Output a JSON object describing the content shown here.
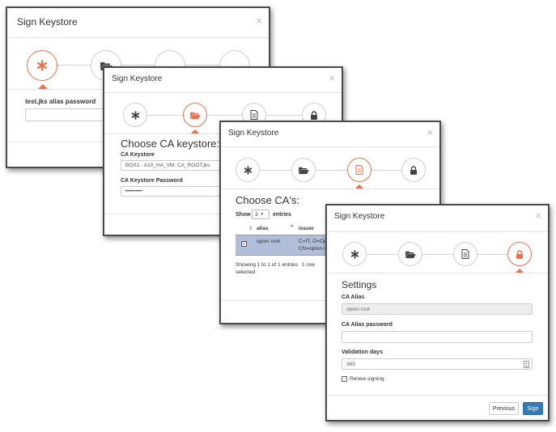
{
  "dialog_title": "Sign Keystore",
  "close_symbol": "×",
  "accent_color": "#e8734e",
  "primary_color": "#337ab7",
  "step_icons": [
    "asterisk-icon",
    "folder-open-icon",
    "file-text-icon",
    "lock-icon"
  ],
  "step1": {
    "field_label": "test.jks alias password",
    "field_value": ""
  },
  "step2": {
    "heading": "Choose CA keystore:",
    "keystore_label": "CA Keystore",
    "keystore_value": "BOX1 - A10_HA_VM: CA_ROOT.jks",
    "password_label": "CA Keystore Password",
    "password_value": "••••••••••"
  },
  "step3": {
    "heading": "Choose CA's:",
    "show_label": "Show",
    "page_size": "3",
    "entries_label": "entries",
    "columns": [
      "alias",
      "issuer"
    ],
    "rows": [
      {
        "alias": "opion root",
        "issuer_line1": "C=IT, O=Op",
        "issuer_line2": "CN=opion ro"
      }
    ],
    "info_text": "Showing 1 to 1 of 1 entries",
    "selected_text": "1 row",
    "selected_text2": "selected"
  },
  "step4": {
    "heading": "Settings",
    "ca_alias_label": "CA Alias",
    "ca_alias_value": "opion root",
    "ca_alias_password_label": "CA Alias password",
    "ca_alias_password_value": "",
    "validation_days_label": "Validation days",
    "validation_days_value": "365",
    "renew_label": "Renew signing",
    "previous_button": "Previous",
    "sign_button": "Sign"
  }
}
